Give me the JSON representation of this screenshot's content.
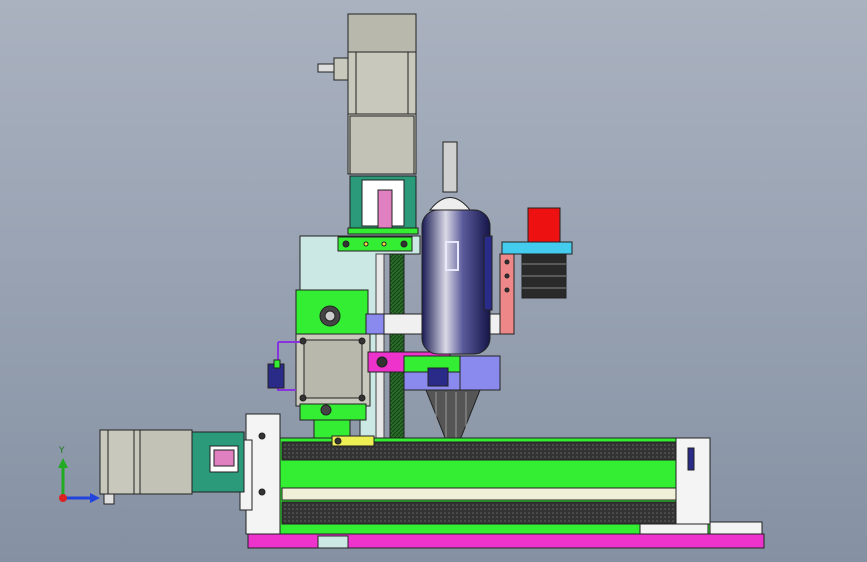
{
  "viewport": {
    "background_top": "#aab2c0",
    "background_bottom": "#8591a3"
  },
  "triad": {
    "y_label": "Y",
    "colors": {
      "y": "#22aa22",
      "x": "#2244dd",
      "z": "#dd2222"
    }
  },
  "palette": {
    "motor_body": "#c8c8bc",
    "frame_green": "#33ee33",
    "base_magenta": "#ee33cc",
    "bracket_cyan": "#cce8e4",
    "coupling_teal": "#2a9a7a",
    "brush_gray": "#3c3c3c",
    "spindle_blue": "#2a2a88",
    "laser_red": "#ee1111",
    "arm_salmon": "#ee8888",
    "block_lavender": "#8a8aee",
    "white": "#f4f4f4"
  }
}
